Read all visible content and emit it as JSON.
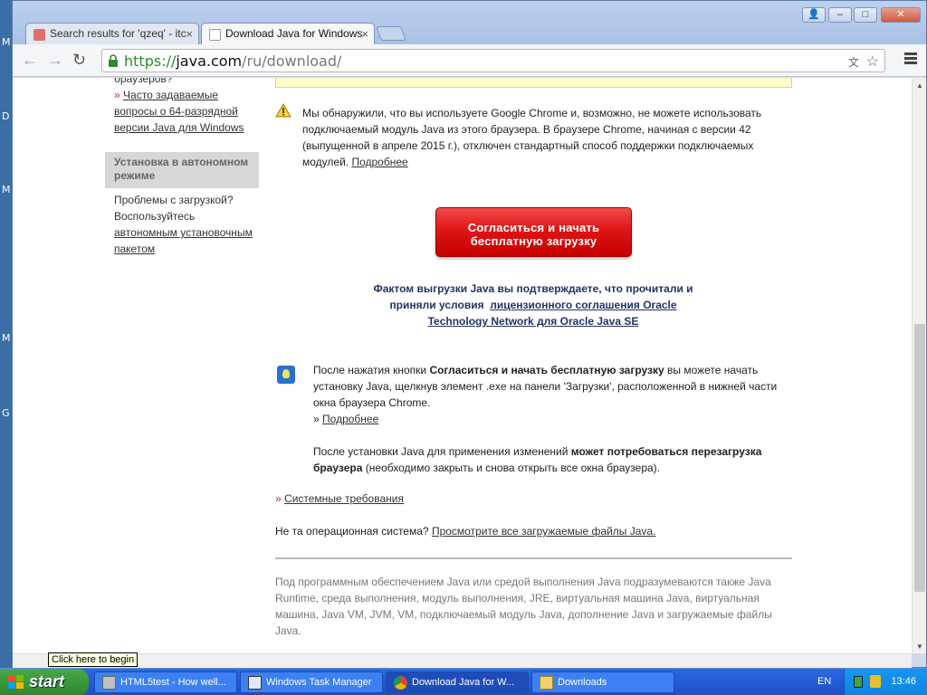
{
  "desktop": {
    "letters": [
      "M",
      "D",
      "M",
      "M",
      "G"
    ]
  },
  "browser": {
    "tabs": [
      {
        "title": "Search results for 'qzeq' - itc",
        "close": "×"
      },
      {
        "title": "Download Java for Windows",
        "close": "×"
      }
    ],
    "window_buttons": {
      "user": "👤",
      "minimize": "–",
      "maximize": "□",
      "close": "✕"
    },
    "url": {
      "scheme": "https://",
      "host": "java.com",
      "path": "/ru/download/"
    }
  },
  "page": {
    "sidebar": {
      "faq_prefix": "браузеров?",
      "faq_link_lines": [
        "Часто задаваемые",
        "вопросы о 64-разрядной",
        "версии Java для Windows"
      ],
      "offline_heading": "Установка в автономном режиме",
      "problems_text": "Проблемы с загрузкой? Воспользуйтесь",
      "offline_link": "автономным установочным пакетом"
    },
    "warning": {
      "text": "Мы обнаружили, что вы используете Google Chrome и, возможно, не можете использовать подключаемый модуль Java из этого браузера. В браузере Chrome, начиная с версии 42 (выпущенной в апреле 2015 г.), отключен стандартный способ поддержки подключаемых модулей.",
      "more_link": "Подробнее"
    },
    "download_button": {
      "line1": "Согласиться и начать",
      "line2": "бесплатную загрузку"
    },
    "accept": {
      "line1": "Фактом выгрузки Java вы подтверждаете, что прочитали и",
      "line2_prefix": "приняли условия",
      "license_link_part1": "лицензионного соглашения Oracle",
      "license_link_part2": "Technology Network для Oracle Java SE"
    },
    "after_click": {
      "p1_start": "После нажатия кнопки",
      "p1_bold": "Согласиться и начать бесплатную загрузку",
      "p1_end": "вы можете начать установку Java, щелкнув элемент .exe на панели 'Загрузки', расположенной в нижней части окна браузера Chrome.",
      "more_link": "Подробнее",
      "p2_start": "После установки Java для применения изменений",
      "p2_bold": "может потребоваться перезагрузка браузера",
      "p2_end": "(необходимо закрыть и снова открыть все окна браузера)."
    },
    "sysreq_link": "Системные требования",
    "other_os": {
      "text": "Не та операционная система?",
      "link": "Просмотрите все загружаемые файлы Java."
    },
    "footnote": "Под программным обеспечением Java или средой выполнения Java подразумеваются также Java Runtime, среда выполнения, модуль выполнения, JRE, виртуальная машина Java, виртуальная машина, Java VM, JVM, VM, подключаемый модуль Java, дополнение Java и загружаемые файлы Java."
  },
  "taskbar": {
    "start_label": "start",
    "tooltip": "Click here to begin",
    "tasks": [
      {
        "label": "HTML5test - How well..."
      },
      {
        "label": "Windows Task Manager"
      },
      {
        "label": "Download Java for W..."
      },
      {
        "label": "Downloads"
      }
    ],
    "language": "EN",
    "clock": "13:46"
  },
  "colors": {
    "accent_red": "#e01515",
    "link_navy": "#223366",
    "xp_blue": "#245edb",
    "start_green": "#3a973a"
  }
}
